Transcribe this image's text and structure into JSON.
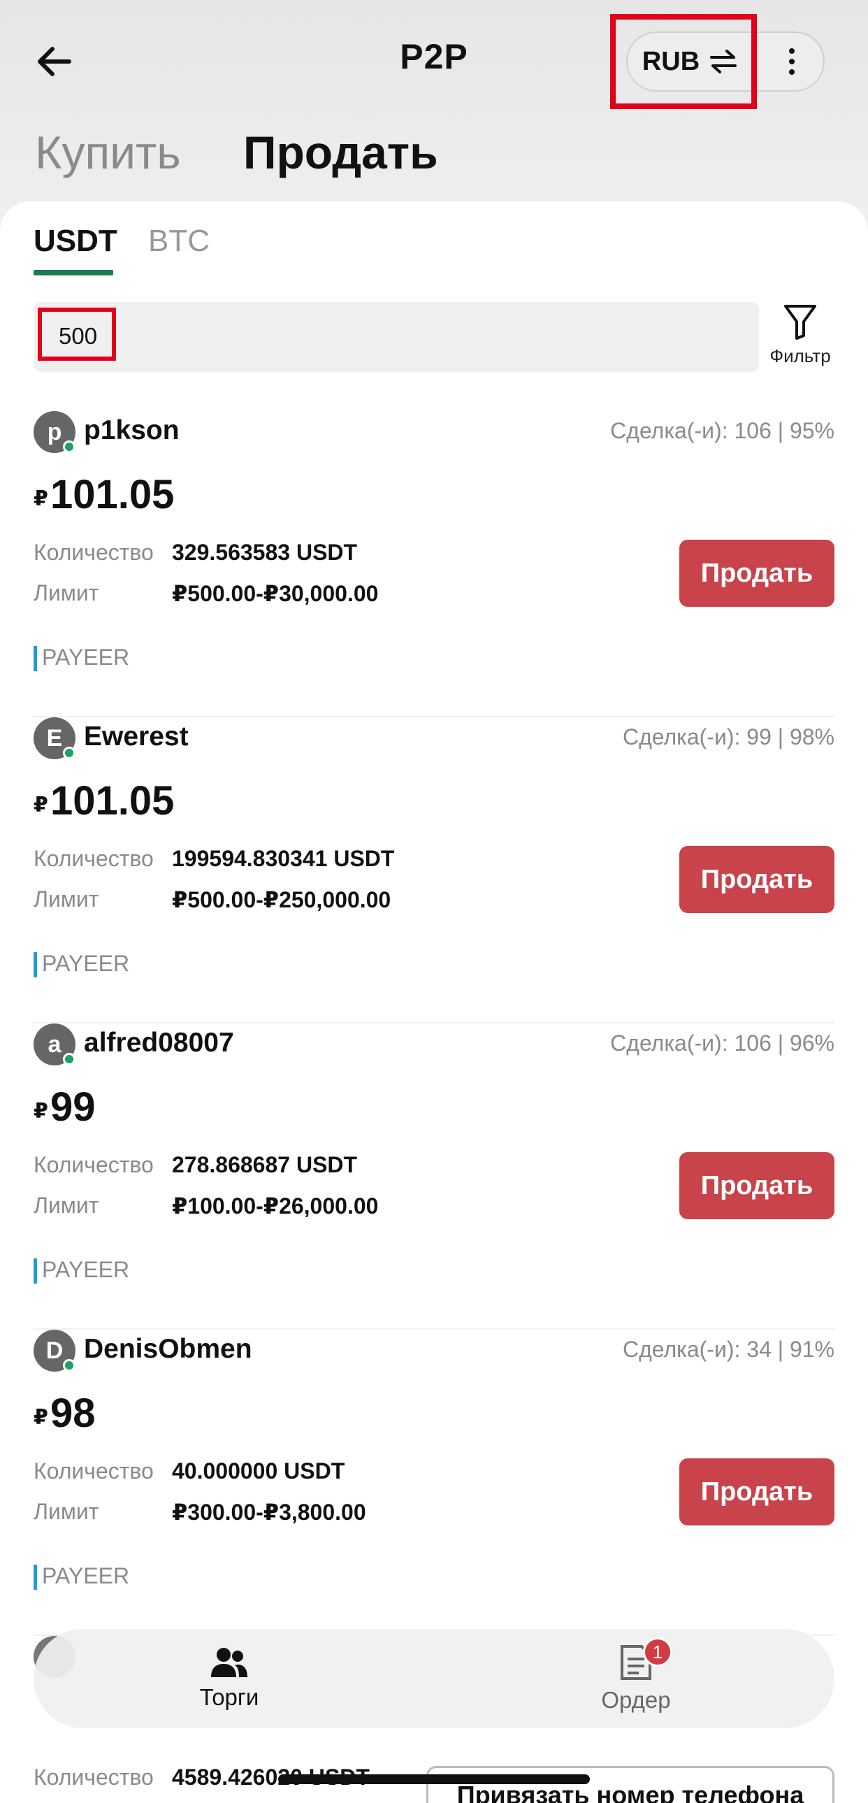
{
  "header": {
    "title": "P2P",
    "currency": "RUB",
    "modes": {
      "buy": "Купить",
      "sell": "Продать"
    }
  },
  "coins": {
    "active": "USDT",
    "other": "BTC"
  },
  "amount_input": {
    "value": "500"
  },
  "filter": {
    "label": "Фильтр"
  },
  "offers": [
    {
      "initial": "p",
      "name": "p1kson",
      "stats": "Сделка(-и): 106 | 95%",
      "currency_symbol": "₽",
      "price": "101.05",
      "qty_label": "Количество",
      "qty": "329.563583 USDT",
      "limit_label": "Лимит",
      "limit": "₽500.00-₽30,000.00",
      "payment": "PAYEER",
      "action": "Продать"
    },
    {
      "initial": "E",
      "name": "Ewerest",
      "stats": "Сделка(-и): 99 | 98%",
      "currency_symbol": "₽",
      "price": "101.05",
      "qty_label": "Количество",
      "qty": "199594.830341 USDT",
      "limit_label": "Лимит",
      "limit": "₽500.00-₽250,000.00",
      "payment": "PAYEER",
      "action": "Продать"
    },
    {
      "initial": "a",
      "name": "alfred08007",
      "stats": "Сделка(-и): 106 | 96%",
      "currency_symbol": "₽",
      "price": "99",
      "qty_label": "Количество",
      "qty": "278.868687 USDT",
      "limit_label": "Лимит",
      "limit": "₽100.00-₽26,000.00",
      "payment": "PAYEER",
      "action": "Продать"
    },
    {
      "initial": "D",
      "name": "DenisObmen",
      "stats": "Сделка(-и): 34 | 91%",
      "currency_symbol": "₽",
      "price": "98",
      "qty_label": "Количество",
      "qty": "40.000000 USDT",
      "limit_label": "Лимит",
      "limit": "₽300.00-₽3,800.00",
      "payment": "PAYEER",
      "action": "Продать"
    }
  ],
  "partial_offer": {
    "qty_label": "Количество",
    "qty": "4589.426020 USDT"
  },
  "bottom_nav": {
    "trades": "Торги",
    "orders": "Ордер",
    "orders_badge": "1"
  },
  "bind_phone": "Привязать номер телефона",
  "colors": {
    "sell_button": "#c8434a",
    "tab_underline": "#1f7a4f",
    "payment_bar": "#1e9cd7",
    "online": "#1aa260",
    "highlight": "#e3001b"
  }
}
